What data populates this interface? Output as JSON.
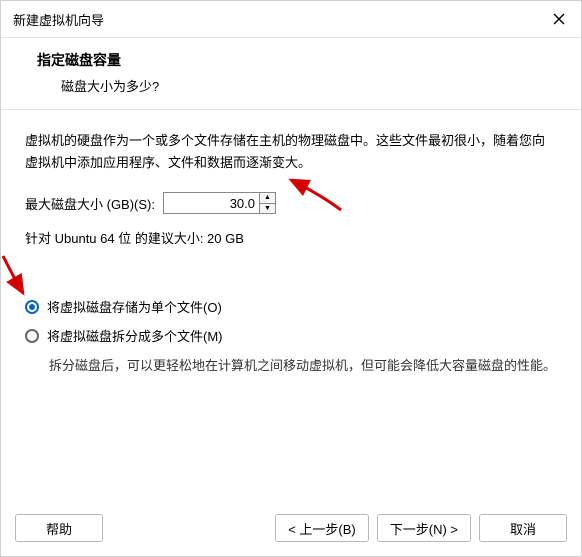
{
  "window": {
    "title": "新建虚拟机向导"
  },
  "header": {
    "title": "指定磁盘容量",
    "subtitle": "磁盘大小为多少?"
  },
  "body": {
    "description": "虚拟机的硬盘作为一个或多个文件存储在主机的物理磁盘中。这些文件最初很小，随着您向虚拟机中添加应用程序、文件和数据而逐渐变大。",
    "size_label": "最大磁盘大小 (GB)(S):",
    "size_value": "30.0",
    "recommendation": "针对 Ubuntu 64 位 的建议大小: 20 GB",
    "options": {
      "single": "将虚拟磁盘存储为单个文件(O)",
      "split": "将虚拟磁盘拆分成多个文件(M)",
      "split_hint": "拆分磁盘后，可以更轻松地在计算机之间移动虚拟机，但可能会降低大容量磁盘的性能。",
      "selected": "single"
    }
  },
  "footer": {
    "help": "帮助",
    "back": "< 上一步(B)",
    "next": "下一步(N) >",
    "cancel": "取消"
  }
}
